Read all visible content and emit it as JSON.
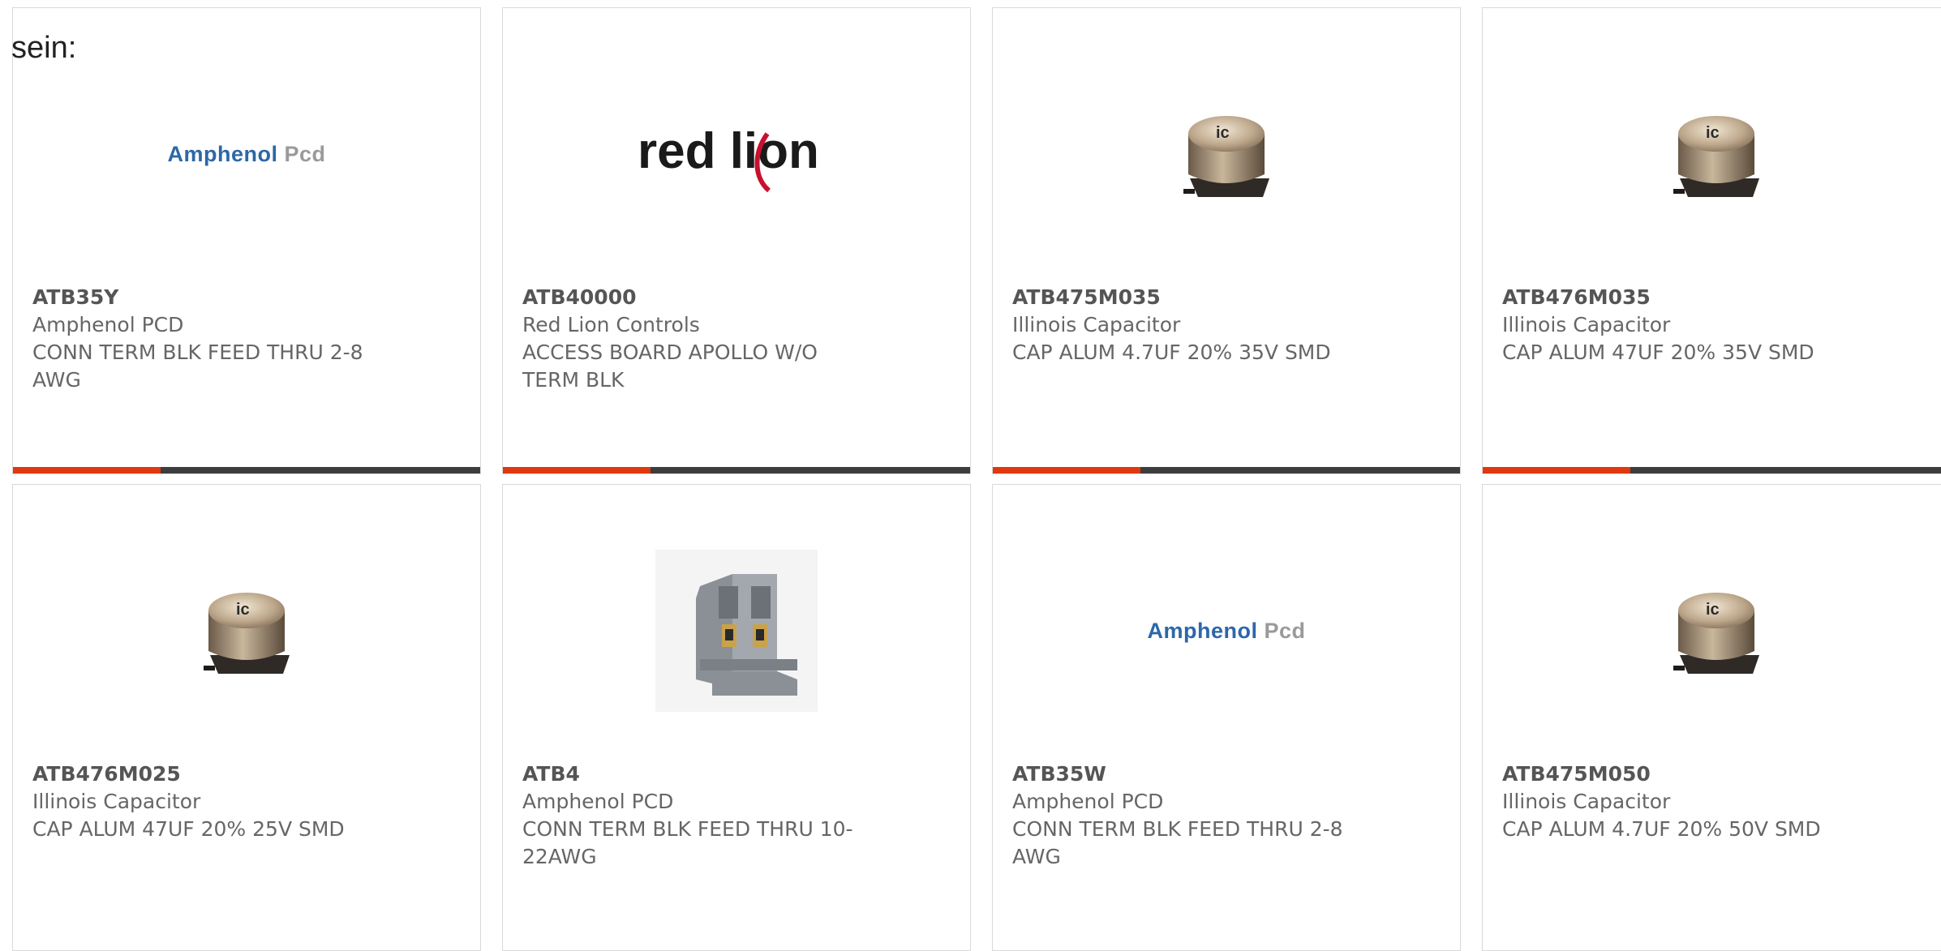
{
  "lead_text": "sein:",
  "products": [
    {
      "part": "ATB35Y",
      "maker": "Amphenol PCD",
      "desc": "CONN TERM BLK FEED THRU 2-8 AWG",
      "image": "amphenol-logo"
    },
    {
      "part": "ATB40000",
      "maker": "Red Lion Controls",
      "desc": "ACCESS BOARD APOLLO W/O TERM BLK",
      "image": "redlion-logo"
    },
    {
      "part": "ATB475M035",
      "maker": "Illinois Capacitor",
      "desc": "CAP ALUM 4.7UF 20% 35V SMD",
      "image": "capacitor"
    },
    {
      "part": "ATB476M035",
      "maker": "Illinois Capacitor",
      "desc": "CAP ALUM 47UF 20% 35V SMD",
      "image": "capacitor"
    },
    {
      "part": "ATB476M025",
      "maker": "Illinois Capacitor",
      "desc": "CAP ALUM 47UF 20% 25V SMD",
      "image": "capacitor"
    },
    {
      "part": "ATB4",
      "maker": "Amphenol PCD",
      "desc": "CONN TERM BLK FEED THRU 10-22AWG",
      "image": "terminal-block"
    },
    {
      "part": "ATB35W",
      "maker": "Amphenol PCD",
      "desc": "CONN TERM BLK FEED THRU 2-8 AWG",
      "image": "amphenol-logo"
    },
    {
      "part": "ATB475M050",
      "maker": "Illinois Capacitor",
      "desc": "CAP ALUM 4.7UF 20% 50V SMD",
      "image": "capacitor"
    }
  ],
  "logos": {
    "amphenol_main": "Amphenol",
    "amphenol_sub": "Pcd",
    "redlion": "red lion",
    "capacitor_mark": "ic"
  },
  "colors": {
    "accent": "#e0380f",
    "bar": "#3d3d3d",
    "amphenol_blue": "#2d67a8",
    "redlion_red": "#c8102e"
  }
}
